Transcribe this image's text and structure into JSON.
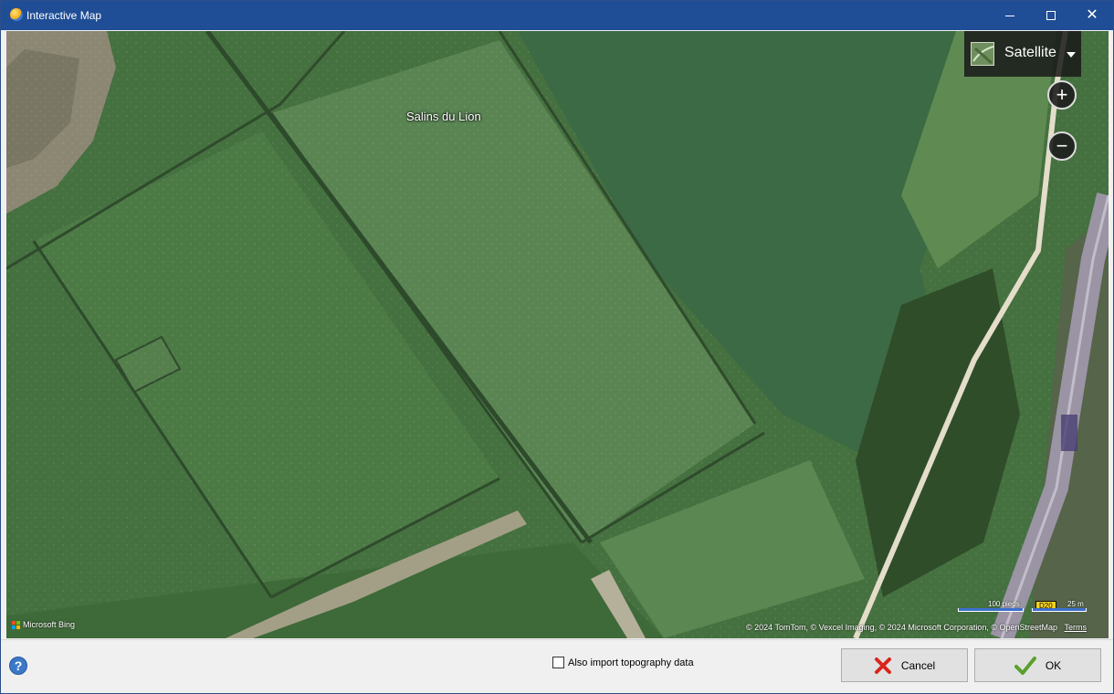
{
  "window": {
    "title": "Interactive Map",
    "minimize_label": "Minimize",
    "maximize_label": "Maximize",
    "close_label": "Close"
  },
  "map": {
    "place_label": "Salins du Lion",
    "layer": {
      "selected": "Satellite",
      "icon": "satellite-thumbnail-icon"
    },
    "zoom_in_icon": "plus-icon",
    "zoom_out_icon": "minus-icon",
    "provider": "Microsoft Bing",
    "scale": {
      "primary_label": "100 pieds",
      "secondary_label": "25 m"
    },
    "road_badge": "D20",
    "copyright": "© 2024 TomTom, © Vexcel Imaging, © 2024 Microsoft Corporation, © OpenStreetMap",
    "terms_link": "Terms"
  },
  "footer": {
    "help_icon": "help-icon",
    "topography_checkbox": {
      "label": "Also import topography data",
      "checked": false
    },
    "cancel_label": "Cancel",
    "ok_label": "OK"
  },
  "colors": {
    "titlebar": "#1f4e96",
    "map_green": "#3f6a3b",
    "cancel_icon": "#d9251d",
    "ok_icon": "#5aa02c"
  }
}
